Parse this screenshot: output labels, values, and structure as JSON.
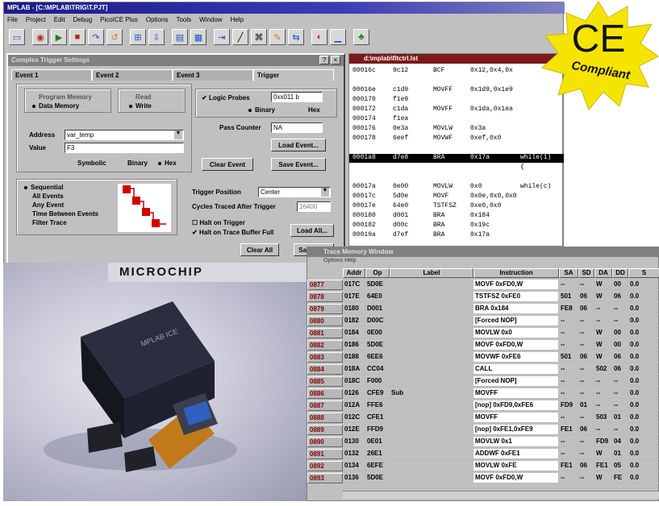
{
  "ide": {
    "title": "MPLAB - [C:\\MPLAB\\TRIG\\T.PJT]",
    "menu": [
      "File",
      "Project",
      "Edit",
      "Debug",
      "PicoICE Plus",
      "Options",
      "Tools",
      "Window",
      "Help"
    ]
  },
  "trigger_dialog": {
    "title": "Complex Trigger Settings",
    "tabs": [
      "Event 1",
      "Event 2",
      "Event 3",
      "Trigger"
    ],
    "memory_options": [
      "Program Memory",
      "Data Memory"
    ],
    "access_options": [
      "Read",
      "Write"
    ],
    "address_label": "Address",
    "address_value": "var_temp",
    "value_label": "Value",
    "value_value": "F3",
    "format_options": [
      "Symbolic",
      "Binary",
      "Hex"
    ],
    "clear_event_1": "Clear Event",
    "logic_probes_label": "Logic Probes",
    "logic_probes_value": "0xx011 b",
    "probe_format": [
      "Binary",
      "Hex"
    ],
    "pass_counter_label": "Pass Counter",
    "pass_counter_value": "NA",
    "load_event": "Load Event...",
    "clear_event_2": "Clear Event",
    "save_event": "Save Event...",
    "sequence_options": [
      "Sequential",
      "All Events",
      "Any Event",
      "Time Between Events",
      "Filter Trace"
    ],
    "trigger_position_label": "Trigger Position",
    "trigger_position_value": "Center",
    "cycles_label": "Cycles Traced After Trigger",
    "cycles_value": "16400",
    "halt_trigger": "Halt on Trigger",
    "halt_buffer": "Halt on Trace Buffer Full",
    "load_all": "Load All...",
    "clear_all": "Clear All",
    "save_all": "Save All..."
  },
  "disassembly": {
    "title": "d:\\mplab\\fltctrl.lst",
    "rows": [
      {
        "addr": "00016c",
        "op": "9c12",
        "mn": "BCF",
        "arg": "0x12,0x4,0x"
      },
      {
        "addr": "",
        "op": "",
        "mn": "",
        "arg": ""
      },
      {
        "addr": "00016e",
        "op": "c1d9",
        "mn": "MOVFF",
        "arg": "0x1d9,0x1e9"
      },
      {
        "addr": "000170",
        "op": "f1e9",
        "mn": "",
        "arg": ""
      },
      {
        "addr": "000172",
        "op": "c1da",
        "mn": "MOVFF",
        "arg": "0x1da,0x1ea"
      },
      {
        "addr": "000174",
        "op": "f1ea",
        "mn": "",
        "arg": ""
      },
      {
        "addr": "000176",
        "op": "0e3a",
        "mn": "MOVLW",
        "arg": "0x3a"
      },
      {
        "addr": "000178",
        "op": "6eef",
        "mn": "MOVWF",
        "arg": "0xef,0x0"
      },
      {
        "addr": "",
        "op": "",
        "mn": "",
        "arg": ""
      },
      {
        "addr": "0001a8",
        "op": "d7e8",
        "mn": "BRA",
        "arg": "0x17a",
        "src": "while(1)"
      },
      {
        "addr": "",
        "op": "",
        "mn": "",
        "arg": "",
        "src": "{"
      },
      {
        "addr": "",
        "op": "",
        "mn": "",
        "arg": ""
      },
      {
        "addr": "00017a",
        "op": "0e00",
        "mn": "MOVLW",
        "arg": "0x0",
        "src": "while(c)"
      },
      {
        "addr": "00017c",
        "op": "5d0e",
        "mn": "MOVF",
        "arg": "0x0e,0x0,0x0"
      },
      {
        "addr": "00017e",
        "op": "64e0",
        "mn": "TSTFSZ",
        "arg": "0xe0,0x0"
      },
      {
        "addr": "000180",
        "op": "d001",
        "mn": "BRA",
        "arg": "0x184"
      },
      {
        "addr": "000182",
        "op": "d00c",
        "mn": "BRA",
        "arg": "0x19c"
      },
      {
        "addr": "00019a",
        "op": "d7ef",
        "mn": "BRA",
        "arg": "0x17a"
      }
    ]
  },
  "trace": {
    "title": "Trace Memory Window",
    "menu": "Options  Help",
    "columns": [
      "Addr",
      "Op",
      "Label",
      "Instruction",
      "SA",
      "SD",
      "DA",
      "DD",
      "S"
    ],
    "rows": [
      [
        "0877",
        "017C",
        "5D0E",
        "",
        "MOVF 0xFD0,W",
        "--",
        "--",
        "W",
        "00",
        "0.0"
      ],
      [
        "0878",
        "017E",
        "64E0",
        "",
        "TSTFSZ 0xFE0",
        "501",
        "06",
        "W",
        "06",
        "0.0"
      ],
      [
        "0879",
        "0180",
        "D001",
        "",
        "BRA 0x184",
        "FE8",
        "06",
        "--",
        "--",
        "0.0"
      ],
      [
        "0880",
        "0182",
        "D00C",
        "",
        "[Forced NOP]",
        "--",
        "--",
        "--",
        "--",
        "0.0"
      ],
      [
        "0881",
        "0184",
        "0E00",
        "",
        "MOVLW 0x0",
        "--",
        "--",
        "W",
        "00",
        "0.0"
      ],
      [
        "0882",
        "0186",
        "5D0E",
        "",
        "MOVF 0xFD0,W",
        "--",
        "--",
        "W",
        "00",
        "0.0"
      ],
      [
        "0883",
        "0188",
        "6EE6",
        "",
        "MOVWF 0xFE6",
        "501",
        "06",
        "W",
        "06",
        "0.0"
      ],
      [
        "0884",
        "018A",
        "CC04",
        "",
        "CALL",
        "--",
        "--",
        "502",
        "06",
        "0.0"
      ],
      [
        "0885",
        "018C",
        "F000",
        "",
        "[Forced NOP]",
        "--",
        "--",
        "--",
        "--",
        "0.0"
      ],
      [
        "0886",
        "0126",
        "CFE9",
        "Sub",
        "MOVFF",
        "--",
        "--",
        "--",
        "--",
        "0.0"
      ],
      [
        "0887",
        "012A",
        "FFE6",
        "",
        "[nop] 0xFD9,0xFE6",
        "FD9",
        "01",
        "--",
        "--",
        "0.0"
      ],
      [
        "0888",
        "012C",
        "CFE1",
        "",
        "MOVFF",
        "--",
        "--",
        "503",
        "01",
        "0.0"
      ],
      [
        "0889",
        "012E",
        "FFD9",
        "",
        "[nop] 0xFE1,0xFE9",
        "FE1",
        "06",
        "--",
        "--",
        "0.0"
      ],
      [
        "0890",
        "0130",
        "0E01",
        "",
        "MOVLW 0x1",
        "--",
        "--",
        "FD9",
        "04",
        "0.0"
      ],
      [
        "0891",
        "0132",
        "26E1",
        "",
        "ADDWF 0xFE1",
        "--",
        "--",
        "W",
        "01",
        "0.0"
      ],
      [
        "0892",
        "0134",
        "6EFE",
        "",
        "MOVLW 0xFE",
        "FE1",
        "06",
        "FE1",
        "05",
        "0.0"
      ],
      [
        "0893",
        "0136",
        "5D0E",
        "",
        "MOVF 0xFD0,W",
        "--",
        "--",
        "W",
        "FE",
        "0.0"
      ]
    ]
  },
  "photo": {
    "brand": "MICROCHIP",
    "device_label": "MPLAB ICE"
  },
  "badge": {
    "mark": "CE",
    "text": "Compliant",
    "color": "#f5e400"
  }
}
